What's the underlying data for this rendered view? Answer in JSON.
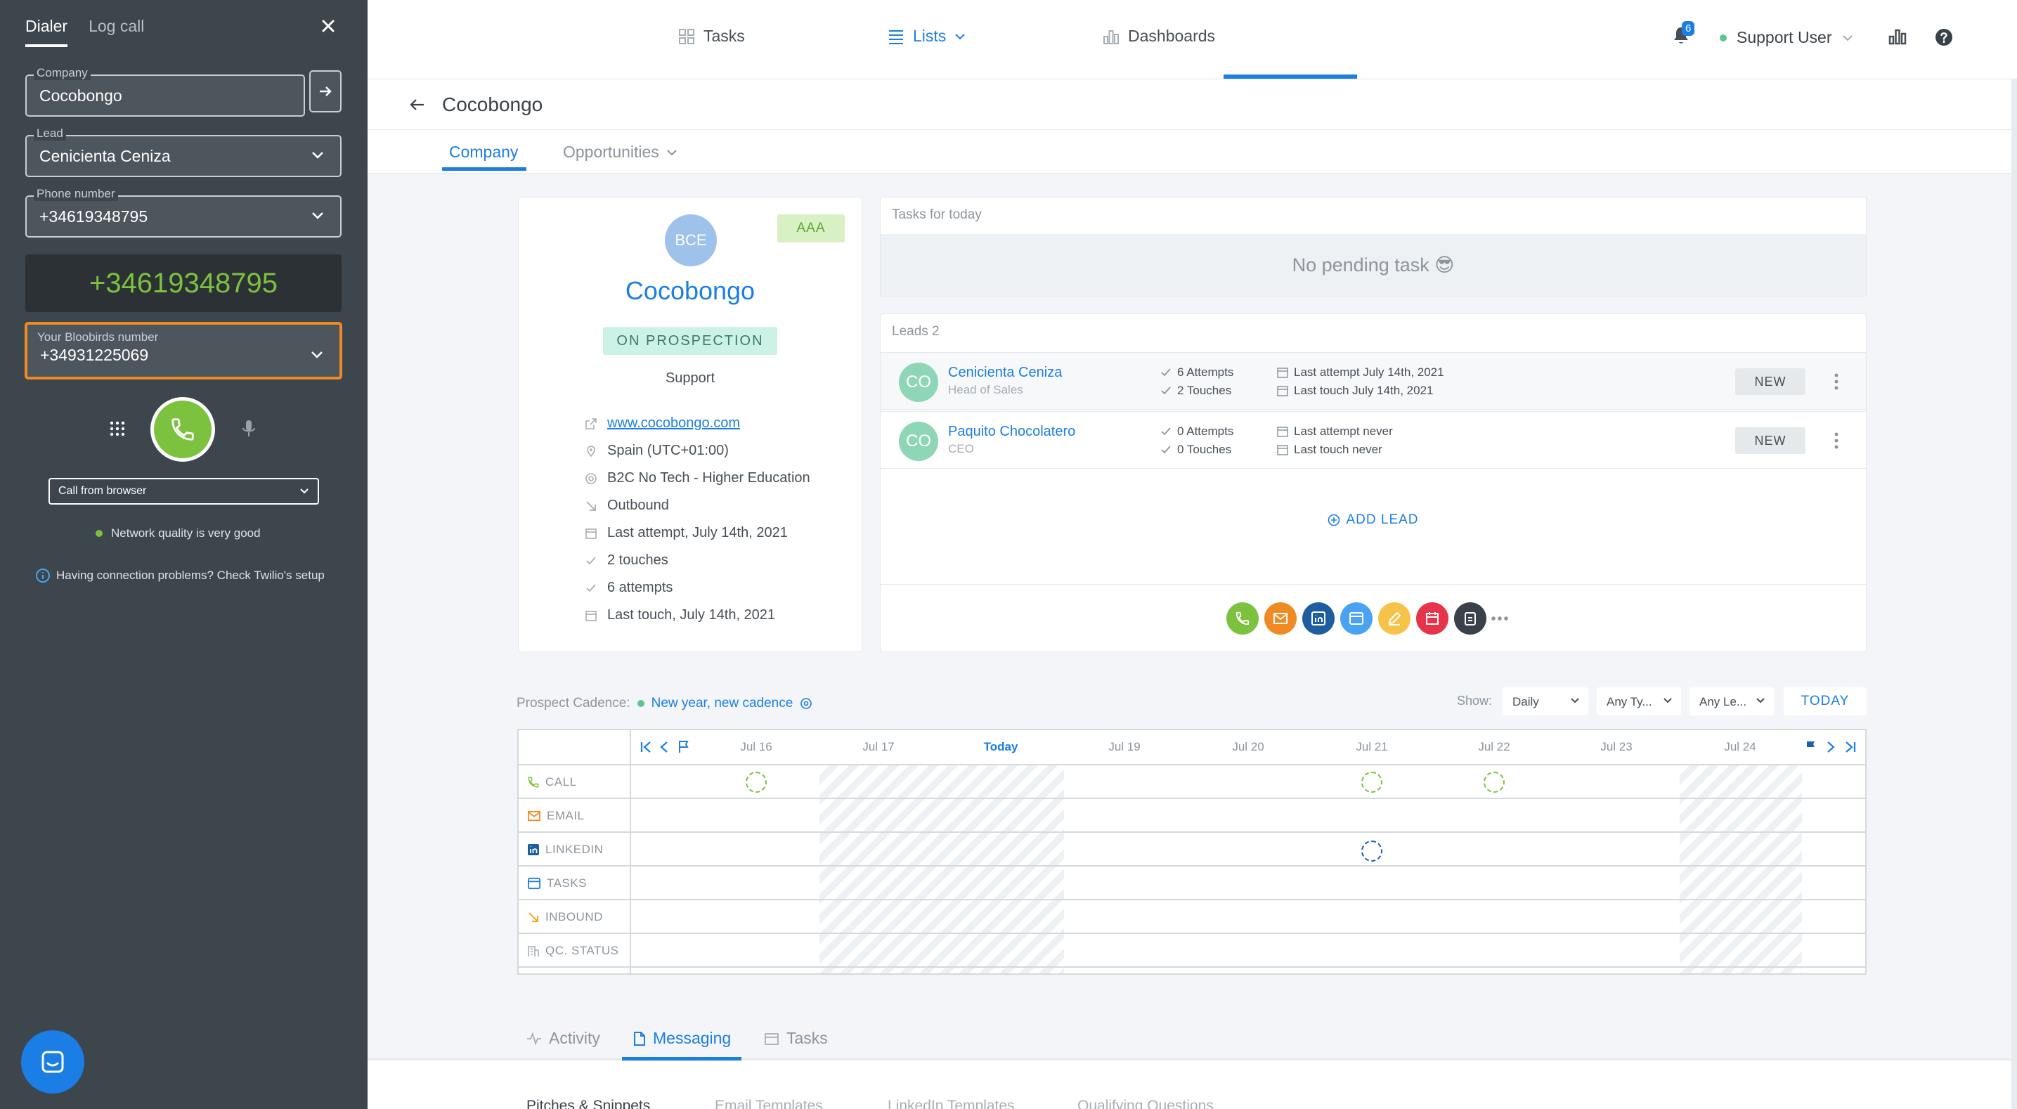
{
  "dialer": {
    "tabs": [
      "Dialer",
      "Log call"
    ],
    "company_label": "Company",
    "company_value": "Cocobongo",
    "lead_label": "Lead",
    "lead_value": "Cenicienta Ceniza",
    "phone_label": "Phone number",
    "phone_value": "+34619348795",
    "display_number": "+34619348795",
    "own_number_label": "Your Bloobirds number",
    "own_number_value": "+34931225069",
    "call_mode": "Call from browser",
    "network_status": "Network quality is very good",
    "help_text": "Having connection problems? Check Twilio's setup"
  },
  "topnav": {
    "tasks": "Tasks",
    "lists": "Lists",
    "dashboards": "Dashboards",
    "notifications": "6",
    "user": "Support User"
  },
  "page": {
    "title": "Cocobongo",
    "tabs": [
      "Company",
      "Opportunities"
    ]
  },
  "company": {
    "initials": "BCE",
    "tier": "AAA",
    "name": "Cocobongo",
    "status": "ON PROSPECTION",
    "owner": "Support",
    "attributes": {
      "website": "www.cocobongo.com",
      "country": "Spain (UTC+01:00)",
      "segment": "B2C No Tech - Higher Education",
      "source": "Outbound",
      "last_attempt": "Last attempt, July 14th, 2021",
      "touches": "2 touches",
      "attempts": "6 attempts",
      "last_touch": "Last touch, July 14th, 2021"
    }
  },
  "tasks_panel": {
    "title": "Tasks for today",
    "empty": "No pending task 😎"
  },
  "leads_panel": {
    "title": "Leads 2",
    "add_label": "ADD LEAD",
    "leads": [
      {
        "initials": "CO",
        "name": "Cenicienta Ceniza",
        "role": "Head of Sales",
        "attempts": "6 Attempts",
        "touches": "2 Touches",
        "last_attempt": "Last attempt July 14th, 2021",
        "last_touch": "Last touch July 14th, 2021",
        "status": "NEW"
      },
      {
        "initials": "CO",
        "name": "Paquito Chocolatero",
        "role": "CEO",
        "attempts": "0 Attempts",
        "touches": "0 Touches",
        "last_attempt": "Last attempt never",
        "last_touch": "Last touch never",
        "status": "NEW"
      }
    ]
  },
  "cadence": {
    "label": "Prospect Cadence:",
    "name": "New year, new cadence",
    "show_label": "Show:",
    "filters": [
      "Daily",
      "Any Ty...",
      "Any Le..."
    ],
    "today_button": "TODAY",
    "days": [
      "Jul 16",
      "Jul 17",
      "Today",
      "Jul 19",
      "Jul 20",
      "Jul 21",
      "Jul 22",
      "Jul 23",
      "Jul 24"
    ],
    "rows": [
      "CALL",
      "EMAIL",
      "LINKEDIN",
      "TASKS",
      "INBOUND",
      "QC. STATUS"
    ]
  },
  "bottom_tabs": [
    "Activity",
    "Messaging",
    "Tasks"
  ],
  "bottom_strip": [
    "Pitches & Snippets",
    "Email Templates",
    "LinkedIn Templates",
    "Qualifying Questions"
  ],
  "colors": {
    "accent": "#1b7ee4",
    "call_green": "#7cc23e",
    "highlight_orange": "#f08a24",
    "dialer_bg": "#3d454d"
  }
}
